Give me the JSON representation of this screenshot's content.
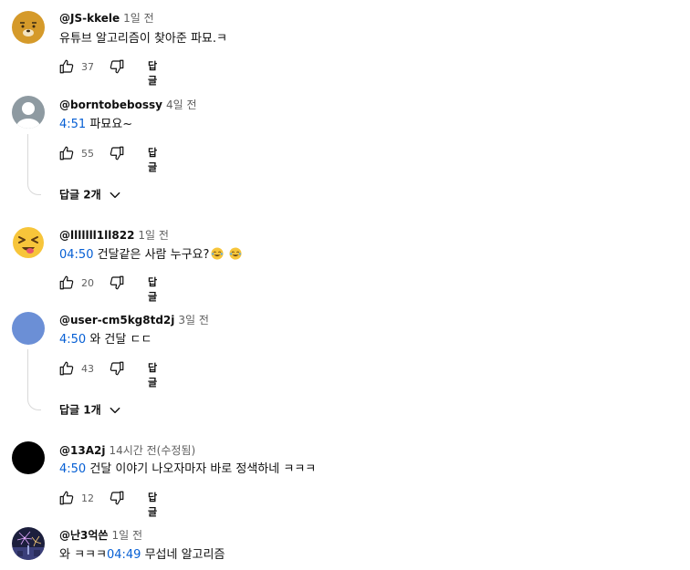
{
  "comments": [
    {
      "author": "@JS-kkele",
      "time": "1일 전",
      "timestamp": "",
      "text": "유튜브 알고리즘이 찾아준 파묘.ㅋ",
      "likes": "37",
      "reply_label": "답글",
      "avatar": "cartoon-bear-avatar",
      "avatar_color": "#d59a2a"
    },
    {
      "author": "@borntobebossy",
      "time": "4일 전",
      "timestamp": "4:51",
      "text": " 파묘요~",
      "likes": "55",
      "reply_label": "답글",
      "replies_toggle": "답글 2개",
      "avatar": "default-user-avatar",
      "avatar_color": "#8e9aa1"
    },
    {
      "author": "@lllllll1ll822",
      "time": "1일 전",
      "timestamp": "04:50",
      "text": " 건달같은 사람 누구요?",
      "likes": "20",
      "reply_label": "답글",
      "avatar": "squinting-face-emoji-avatar",
      "avatar_color": "#f7c53a"
    },
    {
      "author": "@user-cm5kg8td2j",
      "time": "3일 전",
      "timestamp": "4:50",
      "text": " 와 건달 ㄷㄷ",
      "likes": "43",
      "reply_label": "답글",
      "replies_toggle": "답글 1개",
      "avatar": "blue-circle-avatar",
      "avatar_color": "#6b8fd6"
    },
    {
      "author": "@13A2j",
      "time": "14시간 전(수정됨)",
      "timestamp": "4:50",
      "text": " 건달 이야기 나오자마자 바로 정색하네 ㅋㅋㅋ",
      "likes": "12",
      "reply_label": "답글",
      "avatar": "black-circle-avatar",
      "avatar_color": "#000000"
    },
    {
      "author": "@난3억쓴",
      "time": "1일 전",
      "text_before": "와 ㅋㅋㅋ",
      "timestamp": "04:49",
      "text_after": " 무섭네 알고리즘",
      "avatar": "fireworks-photo-avatar",
      "avatar_color": "#3b3f7a"
    }
  ],
  "colors": {
    "link": "#065fd4",
    "meta": "#606060",
    "text": "#0f0f0f"
  }
}
